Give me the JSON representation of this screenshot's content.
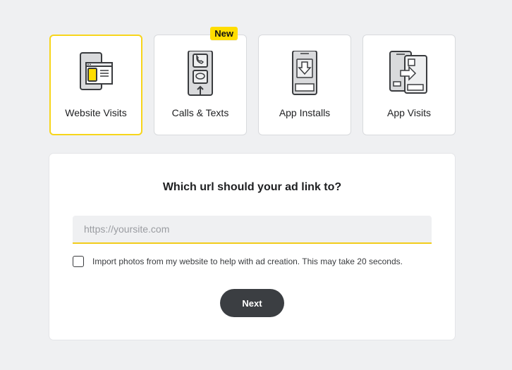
{
  "objectives": [
    {
      "label": "Website Visits",
      "icon": "website-visits-icon",
      "selected": true
    },
    {
      "label": "Calls & Texts",
      "icon": "calls-texts-icon",
      "selected": false,
      "badge": "New"
    },
    {
      "label": "App Installs",
      "icon": "app-installs-icon",
      "selected": false
    },
    {
      "label": "App Visits",
      "icon": "app-visits-icon",
      "selected": false
    }
  ],
  "form": {
    "question": "Which url should your ad link to?",
    "url_placeholder": "https://yoursite.com",
    "url_value": "",
    "import_label": "Import photos from my website to help with ad creation. This may take 20 seconds.",
    "import_checked": false,
    "next_label": "Next"
  },
  "colors": {
    "accent": "#f7d51b",
    "badge": "#ffdd00",
    "button": "#3b3e42",
    "background": "#eff0f2"
  }
}
